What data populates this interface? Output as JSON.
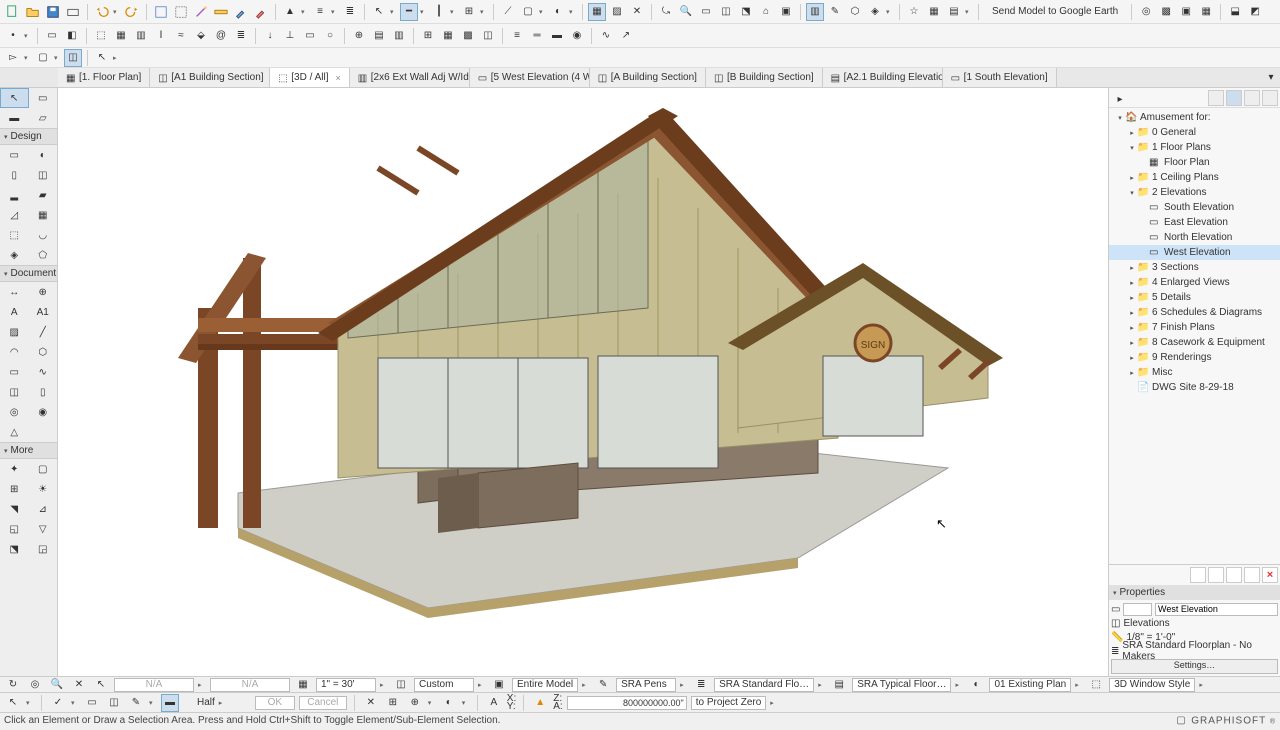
{
  "toolbar": {
    "send_to_ge": "Send Model to Google Earth"
  },
  "tabs": [
    {
      "label": "[1. Floor Plan]",
      "active": false,
      "icon": "plan"
    },
    {
      "label": "[A1 Building Section]",
      "active": false,
      "icon": "section"
    },
    {
      "label": "[3D / All]",
      "active": true,
      "close": true,
      "icon": "3d"
    },
    {
      "label": "[2x6 Ext Wall Adj W/Id…",
      "active": false,
      "icon": "detail"
    },
    {
      "label": "[5 West Elevation (4 W…",
      "active": false,
      "icon": "elev"
    },
    {
      "label": "[A Building Section]",
      "active": false,
      "icon": "section"
    },
    {
      "label": "[B Building Section]",
      "active": false,
      "icon": "section"
    },
    {
      "label": "[A2.1 Building Elevatio",
      "active": false,
      "icon": "layout"
    },
    {
      "label": "[1 South Elevation]",
      "active": false,
      "icon": "elev"
    }
  ],
  "toolbox": {
    "head_design": "Design",
    "head_document": "Document",
    "head_more": "More"
  },
  "navigator": {
    "root": "Amusement for:",
    "items": [
      {
        "lvl": 2,
        "label": "0 General",
        "icon": "folder"
      },
      {
        "lvl": 2,
        "label": "1 Floor Plans",
        "icon": "folder",
        "exp": true
      },
      {
        "lvl": 3,
        "label": "Floor Plan",
        "icon": "plan"
      },
      {
        "lvl": 2,
        "label": "1 Ceiling Plans",
        "icon": "folder"
      },
      {
        "lvl": 2,
        "label": "2 Elevations",
        "icon": "folder",
        "exp": true
      },
      {
        "lvl": 3,
        "label": "South Elevation",
        "icon": "elev"
      },
      {
        "lvl": 3,
        "label": "East Elevation",
        "icon": "elev"
      },
      {
        "lvl": 3,
        "label": "North Elevation",
        "icon": "elev"
      },
      {
        "lvl": 3,
        "label": "West Elevation",
        "icon": "elev",
        "sel": true
      },
      {
        "lvl": 2,
        "label": "3 Sections",
        "icon": "folder"
      },
      {
        "lvl": 2,
        "label": "4 Enlarged Views",
        "icon": "folder"
      },
      {
        "lvl": 2,
        "label": "5 Details",
        "icon": "folder"
      },
      {
        "lvl": 2,
        "label": "6 Schedules & Diagrams",
        "icon": "folder"
      },
      {
        "lvl": 2,
        "label": "7 Finish Plans",
        "icon": "folder"
      },
      {
        "lvl": 2,
        "label": "8 Casework & Equipment",
        "icon": "folder"
      },
      {
        "lvl": 2,
        "label": "9 Renderings",
        "icon": "folder"
      },
      {
        "lvl": 2,
        "label": "Misc",
        "icon": "folder"
      },
      {
        "lvl": 2,
        "label": "DWG Site 8-29-18",
        "icon": "dwg"
      }
    ]
  },
  "props": {
    "head": "Properties",
    "name": "West Elevation",
    "type": "Elevations",
    "scale": "1/8\"   =   1'-0\"",
    "layercombo": "SRA Standard Floorplan - No Makers",
    "settings": "Settings…"
  },
  "quick1": {
    "na1": "N/A",
    "na2": "N/A",
    "scale": "1\"  =  30'",
    "custom": "Custom",
    "model": "Entire Model",
    "pens": "SRA Pens",
    "flo": "SRA Standard Flo…",
    "floor": "SRA Typical Floor…",
    "existing": "01 Existing Plan",
    "style": "3D Window Style"
  },
  "quick2": {
    "half": "Half",
    "ok": "OK",
    "cancel": "Cancel",
    "x_lab": "X:",
    "y_lab": "Y:",
    "z_lab": "Z:",
    "a_lab": "A:",
    "coord": " 800000000.00\"",
    "proj": "to Project Zero"
  },
  "status": {
    "hint": "Click an Element or Draw a Selection Area. Press and Hold Ctrl+Shift to Toggle Element/Sub-Element Selection.",
    "brand": "GRAPHISOFT"
  }
}
